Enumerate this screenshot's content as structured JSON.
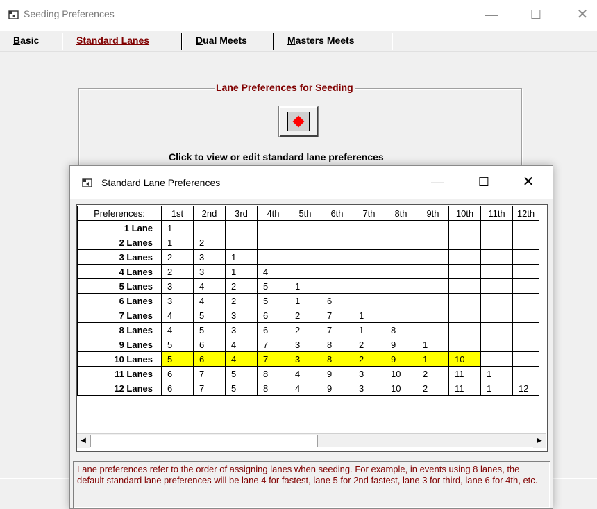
{
  "window": {
    "title": "Seeding Preferences",
    "min": "—",
    "max": "☐",
    "close": "✕"
  },
  "tabs": [
    {
      "label": "Basic",
      "mnemonic": "B",
      "rest": "asic",
      "active": false
    },
    {
      "label": "Standard Lanes",
      "mnemonic": "S",
      "rest": "tandard Lanes",
      "active": true
    },
    {
      "label": "Dual Meets",
      "mnemonic": "D",
      "rest": "ual Meets",
      "active": false
    },
    {
      "label": "Masters Meets",
      "mnemonic": "M",
      "rest": "asters Meets",
      "active": false
    }
  ],
  "group": {
    "legend": "Lane Preferences for Seeding",
    "caption": "Click to view or edit standard lane preferences"
  },
  "dialog": {
    "title": "Standard Lane Preferences",
    "min": "—",
    "max": "☐",
    "close": "✕"
  },
  "grid": {
    "corner": "Preferences:",
    "columns": [
      "1st",
      "2nd",
      "3rd",
      "4th",
      "5th",
      "6th",
      "7th",
      "8th",
      "9th",
      "10th",
      "11th",
      "12th"
    ],
    "highlight_color": "#ffff00",
    "highlight_row": "10 Lanes",
    "rows": [
      {
        "label": "1 Lane",
        "cells": [
          "1",
          "",
          "",
          "",
          "",
          "",
          "",
          "",
          "",
          "",
          "",
          ""
        ]
      },
      {
        "label": "2 Lanes",
        "cells": [
          "1",
          "2",
          "",
          "",
          "",
          "",
          "",
          "",
          "",
          "",
          "",
          ""
        ]
      },
      {
        "label": "3 Lanes",
        "cells": [
          "2",
          "3",
          "1",
          "",
          "",
          "",
          "",
          "",
          "",
          "",
          "",
          ""
        ]
      },
      {
        "label": "4 Lanes",
        "cells": [
          "2",
          "3",
          "1",
          "4",
          "",
          "",
          "",
          "",
          "",
          "",
          "",
          ""
        ]
      },
      {
        "label": "5 Lanes",
        "cells": [
          "3",
          "4",
          "2",
          "5",
          "1",
          "",
          "",
          "",
          "",
          "",
          "",
          ""
        ]
      },
      {
        "label": "6 Lanes",
        "cells": [
          "3",
          "4",
          "2",
          "5",
          "1",
          "6",
          "",
          "",
          "",
          "",
          "",
          ""
        ]
      },
      {
        "label": "7 Lanes",
        "cells": [
          "4",
          "5",
          "3",
          "6",
          "2",
          "7",
          "1",
          "",
          "",
          "",
          "",
          ""
        ]
      },
      {
        "label": "8 Lanes",
        "cells": [
          "4",
          "5",
          "3",
          "6",
          "2",
          "7",
          "1",
          "8",
          "",
          "",
          "",
          ""
        ]
      },
      {
        "label": "9 Lanes",
        "cells": [
          "5",
          "6",
          "4",
          "7",
          "3",
          "8",
          "2",
          "9",
          "1",
          "",
          "",
          ""
        ]
      },
      {
        "label": "10 Lanes",
        "cells": [
          "5",
          "6",
          "4",
          "7",
          "3",
          "8",
          "2",
          "9",
          "1",
          "10",
          "",
          ""
        ]
      },
      {
        "label": "11 Lanes",
        "cells": [
          "6",
          "7",
          "5",
          "8",
          "4",
          "9",
          "3",
          "10",
          "2",
          "11",
          "1",
          ""
        ]
      },
      {
        "label": "12 Lanes",
        "cells": [
          "6",
          "7",
          "5",
          "8",
          "4",
          "9",
          "3",
          "10",
          "2",
          "11",
          "1",
          "12"
        ]
      }
    ]
  },
  "description": "Lane preferences refer to the order of assigning lanes when seeding. For example, in events using 8 lanes, the default standard lane preferences will be lane 4 for fastest, lane 5 for 2nd fastest, lane 3 for third, lane 6 for 4th, etc.",
  "scroll": {
    "left": "◀",
    "right": "▶"
  }
}
